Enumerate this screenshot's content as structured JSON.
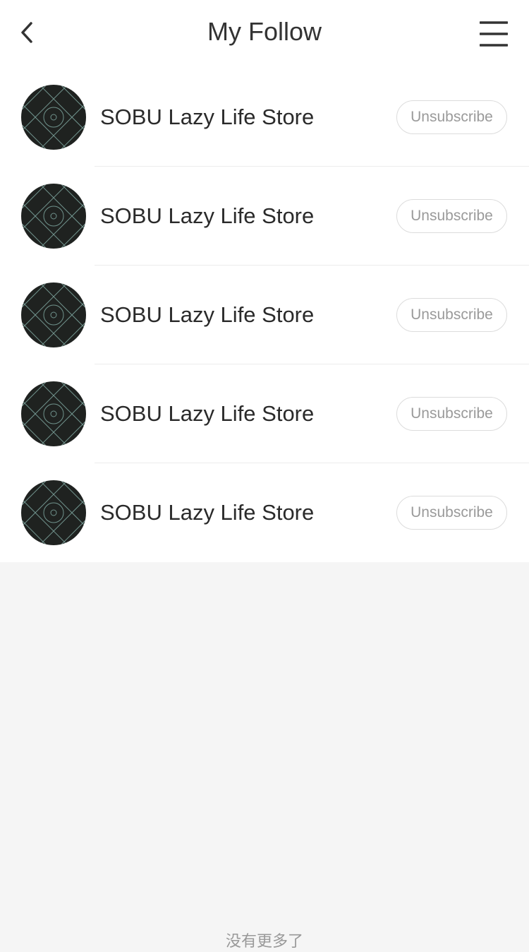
{
  "header": {
    "title": "My Follow",
    "back_icon": "chevron-left-icon",
    "menu_icon": "hamburger-menu-icon"
  },
  "stores": [
    {
      "name": "SOBU Lazy Life Store",
      "action_label": "Unsubscribe"
    },
    {
      "name": "SOBU Lazy Life Store",
      "action_label": "Unsubscribe"
    },
    {
      "name": "SOBU Lazy Life Store",
      "action_label": "Unsubscribe"
    },
    {
      "name": "SOBU Lazy Life Store",
      "action_label": "Unsubscribe"
    },
    {
      "name": "SOBU Lazy Life Store",
      "action_label": "Unsubscribe"
    }
  ],
  "footer": {
    "no_more_text": "没有更多了"
  },
  "colors": {
    "page_bg": "#f5f5f5",
    "card_bg": "#ffffff",
    "text_primary": "#282828",
    "button_border": "#dcdcdc",
    "button_text": "#9a9a9a",
    "avatar_bg": "#1f2220"
  }
}
